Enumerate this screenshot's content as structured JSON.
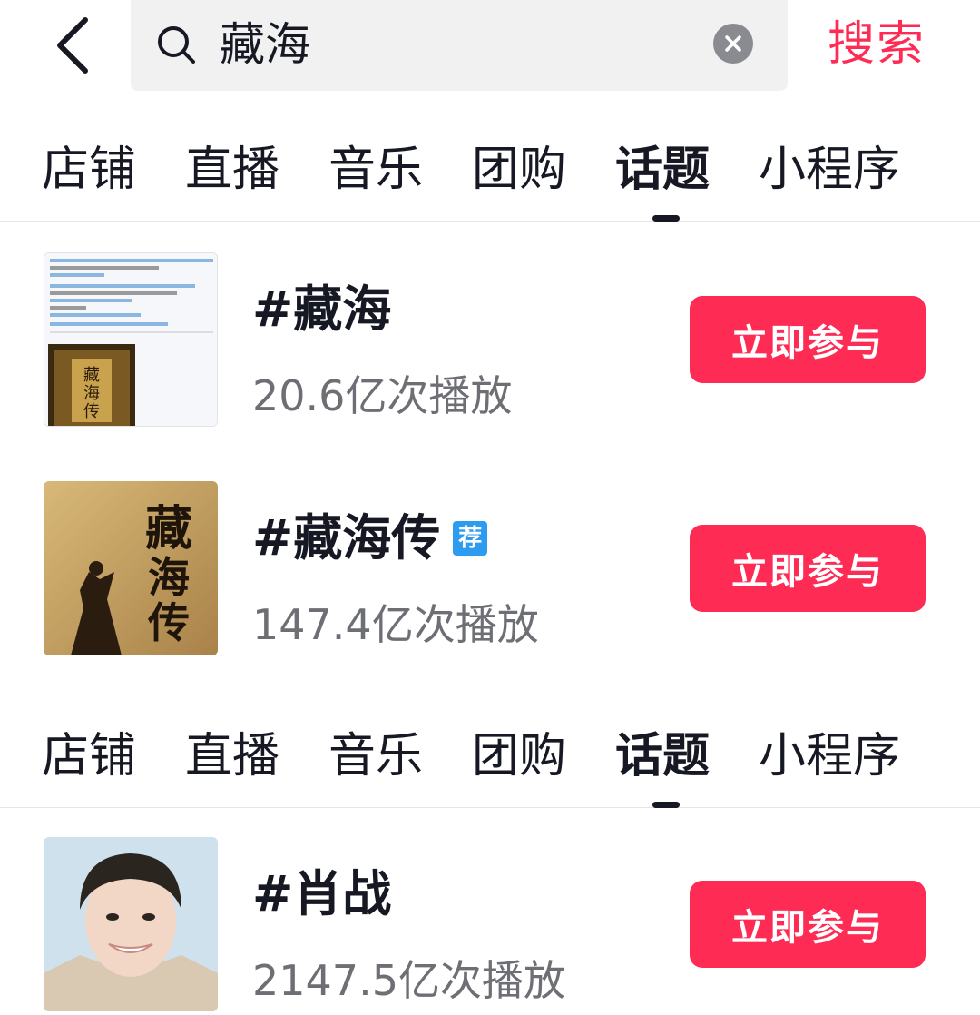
{
  "search": {
    "query": "藏海",
    "action_label": "搜索",
    "back_icon": "chevron-left-icon",
    "search_icon": "magnifier-icon",
    "clear_icon": "clear-icon"
  },
  "tabs": [
    {
      "label": "店铺"
    },
    {
      "label": "直播"
    },
    {
      "label": "音乐"
    },
    {
      "label": "团购"
    },
    {
      "label": "话题",
      "active": true
    },
    {
      "label": "小程序"
    }
  ],
  "topics": [
    {
      "title": "#藏海",
      "views": "20.6亿次播放",
      "join_label": "立即参与",
      "thumb_caption": "藏海传"
    },
    {
      "title": "#藏海传",
      "badge": "荐",
      "views": "147.4亿次播放",
      "join_label": "立即参与",
      "thumb_caption": "藏海传"
    },
    {
      "title": "#肖战",
      "views": "2147.5亿次播放",
      "join_label": "立即参与"
    }
  ],
  "colors": {
    "accent": "#fe2c55",
    "badge": "#2d9bf0",
    "text": "#161823",
    "secondary": "#6e6f75",
    "search_bg": "#f1f1f2"
  }
}
